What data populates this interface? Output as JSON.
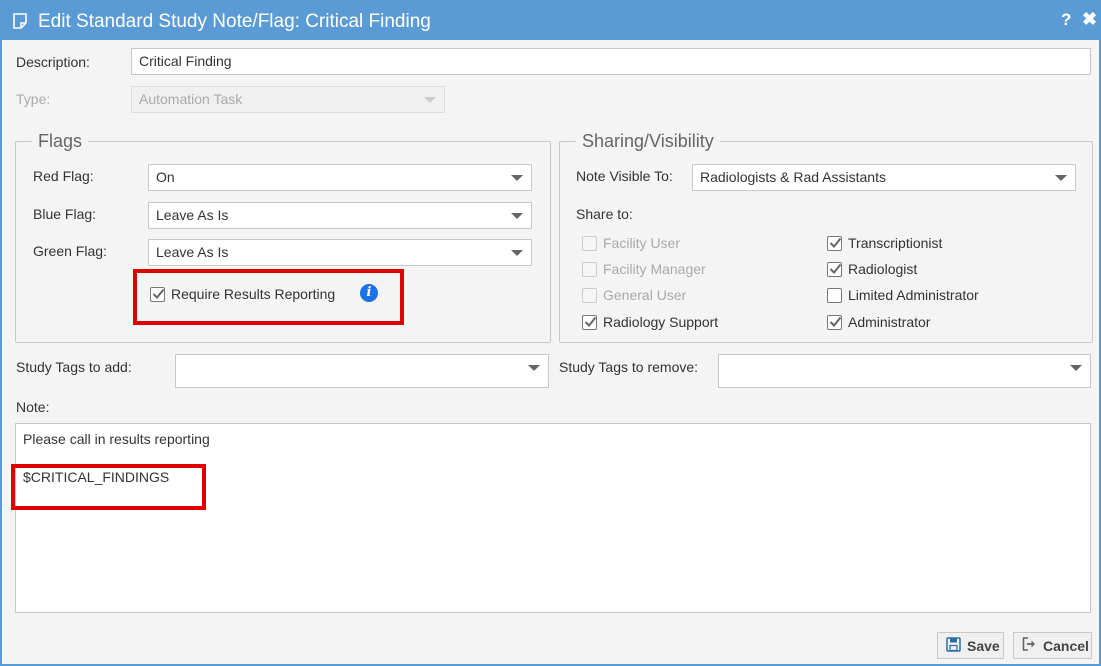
{
  "dialog": {
    "title": "Edit Standard Study Note/Flag: Critical Finding",
    "help_label": "?",
    "close_label": "✖"
  },
  "form": {
    "description_label": "Description:",
    "description_value": "Critical Finding",
    "type_label": "Type:",
    "type_value": "Automation Task"
  },
  "flags": {
    "legend": "Flags",
    "red_label": "Red Flag:",
    "red_value": "On",
    "blue_label": "Blue Flag:",
    "blue_value": "Leave As Is",
    "green_label": "Green Flag:",
    "green_value": "Leave As Is",
    "require_results_label": "Require Results Reporting",
    "require_results_checked": true
  },
  "sharing": {
    "legend": "Sharing/Visibility",
    "visible_to_label": "Note Visible To:",
    "visible_to_value": "Radiologists & Rad Assistants",
    "share_to_label": "Share to:",
    "options": [
      {
        "label": "Facility User",
        "checked": false,
        "disabled": true
      },
      {
        "label": "Facility Manager",
        "checked": false,
        "disabled": true
      },
      {
        "label": "General User",
        "checked": false,
        "disabled": true
      },
      {
        "label": "Radiology Support",
        "checked": true,
        "disabled": false
      },
      {
        "label": "Transcriptionist",
        "checked": true,
        "disabled": false
      },
      {
        "label": "Radiologist",
        "checked": true,
        "disabled": false
      },
      {
        "label": "Limited Administrator",
        "checked": false,
        "disabled": false
      },
      {
        "label": "Administrator",
        "checked": true,
        "disabled": false
      }
    ]
  },
  "tags": {
    "add_label": "Study Tags to add:",
    "remove_label": "Study Tags to remove:"
  },
  "note": {
    "label": "Note:",
    "lines": [
      "Please call in results reporting",
      "",
      "$CRITICAL_FINDINGS"
    ]
  },
  "buttons": {
    "save_label": "Save",
    "cancel_label": "Cancel"
  },
  "colors": {
    "titlebar": "#5b9bd5",
    "highlight": "#e00000",
    "info_icon": "#1a73e8"
  }
}
